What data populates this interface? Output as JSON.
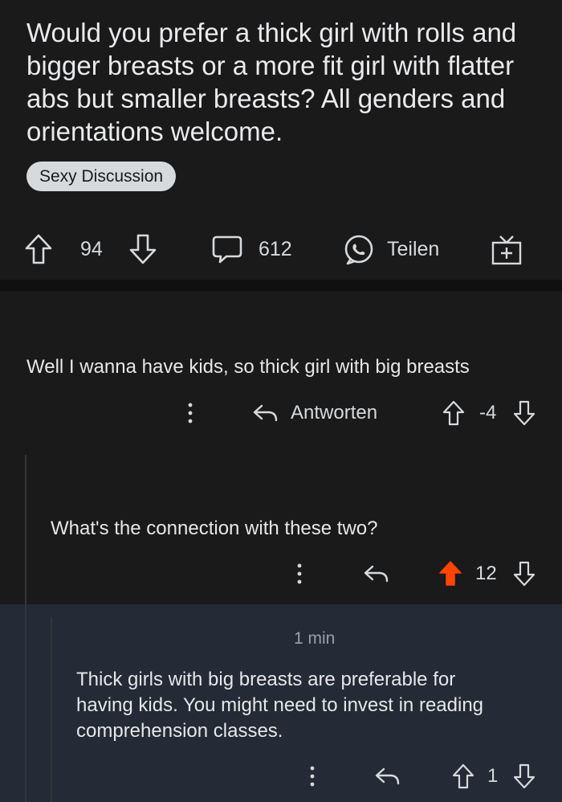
{
  "post": {
    "title": "Would you prefer a thick girl with rolls and bigger breasts or a more fit girl with flatter abs but smaller breasts? All genders and orientations welcome.",
    "flair": "Sexy Discussion",
    "vote_count": "94",
    "comment_count": "612",
    "share_label": "Teilen"
  },
  "comments": [
    {
      "body": "Well I wanna have kids, so thick girl with big breasts",
      "reply_label": "Antworten",
      "score": "-4"
    },
    {
      "body": "What's the connection with these two?",
      "score": "12"
    },
    {
      "timestamp": "1 min",
      "body_lines": [
        "Thick girls with big breasts are preferable for",
        "having kids. You might need to invest in reading",
        "comprehension classes."
      ],
      "score": "1"
    }
  ],
  "colors": {
    "background": "#1a1a1b",
    "highlight": "#242a36",
    "upvote_active": "#ff4500",
    "text": "#d7dadc"
  },
  "icons": [
    "upvote-icon",
    "downvote-icon",
    "comment-icon",
    "share-icon",
    "award-icon",
    "more-icon",
    "reply-icon"
  ]
}
